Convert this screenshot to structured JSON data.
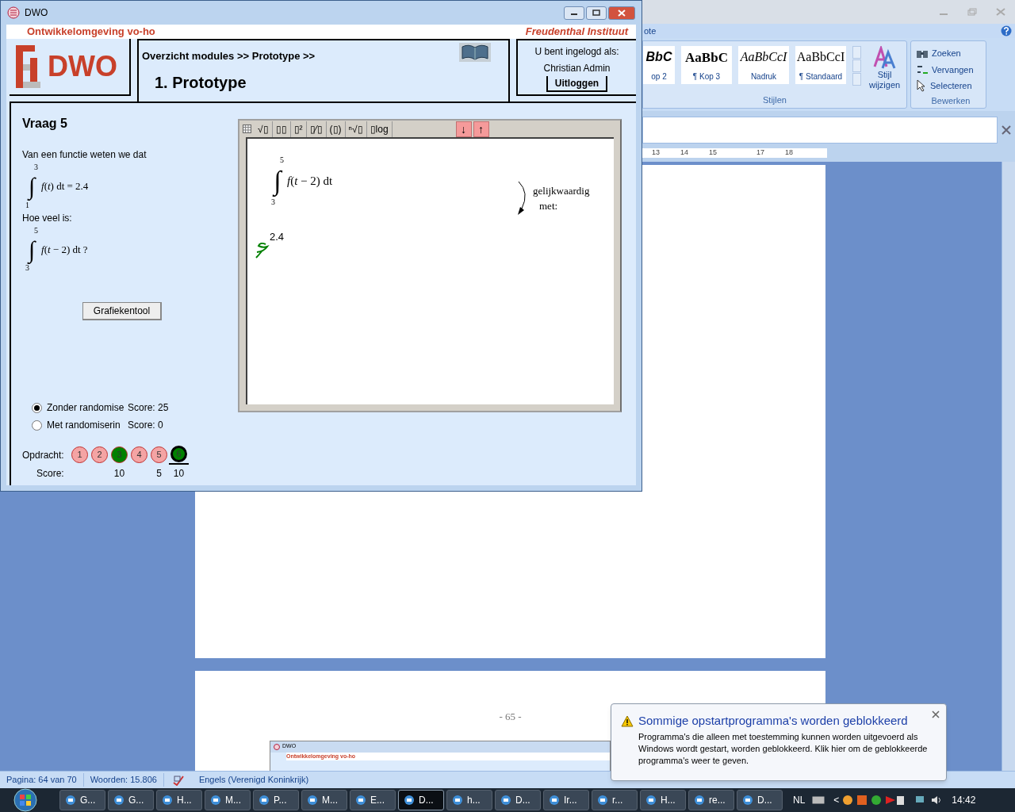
{
  "word": {
    "tab_fragment": "ote",
    "styles": [
      {
        "preview": "BbC",
        "name": "op 2",
        "kind": "bold"
      },
      {
        "preview": "AaBbC",
        "name": "¶ Kop 3",
        "kind": "serifbold"
      },
      {
        "preview": "AaBbCcI",
        "name": "Nadruk",
        "kind": "serifitalic"
      },
      {
        "preview": "AaBbCcI",
        "name": "¶ Standaard",
        "kind": "serif"
      }
    ],
    "change_style": [
      "Stijl",
      "wijzigen"
    ],
    "styles_group": "Stijlen",
    "edit_items": [
      {
        "label": "Zoeken",
        "kind": "find"
      },
      {
        "label": "Vervangen",
        "kind": "replace"
      },
      {
        "label": "Selecteren",
        "kind": "select"
      }
    ],
    "edit_group": "Bewerken",
    "ruler": [
      "13",
      "14",
      "15",
      "17",
      "18"
    ],
    "page_number": "- 65 -",
    "thumbnail": {
      "title": "DWO",
      "header": "Ontwikkelomgeving vo-ho"
    },
    "status_bar": [
      "Pagina: 64 van 70",
      "Woorden: 15.806",
      "Engels (Verenigd Koninkrijk)"
    ]
  },
  "dwo": {
    "title": "DWO",
    "header_left": "Ontwikkelomgeving vo-ho",
    "header_right": "Freudenthal Instituut",
    "logo_text": "DWO",
    "breadcrumb": "Overzicht modules >> Prototype >>",
    "page_title": "1.  Prototype",
    "login": {
      "label": "U bent ingelogd als:",
      "user": "Christian Admin",
      "logout": "Uitloggen"
    },
    "question": {
      "title": "Vraag 5",
      "intro": "Van een functie weten we dat",
      "given": {
        "upper": "3",
        "sign": "∫",
        "lower": "1",
        "expression": "*f*(*t*) dt = 2.4"
      },
      "prompt": "Hoe veel is:",
      "asked": {
        "upper": "5",
        "sign": "∫",
        "lower": "3",
        "expression": "*f*(*t* − 2) dt ?"
      }
    },
    "graph_button": "Grafiekentool",
    "editor": {
      "toolbar": [
        {
          "label": "√▯",
          "kind": "tool"
        },
        {
          "label": "▯▯",
          "kind": "tool"
        },
        {
          "label": "▯²",
          "kind": "tool"
        },
        {
          "label": "▯⁄▯",
          "kind": "tool"
        },
        {
          "label": "(▯)",
          "kind": "tool"
        },
        {
          "label": "ⁿ√▯",
          "kind": "tool"
        },
        {
          "label": "▯log",
          "kind": "tool"
        },
        {
          "label": "↓",
          "kind": "nav"
        },
        {
          "label": "↑",
          "kind": "nav"
        }
      ],
      "integral": {
        "upper": "5",
        "sign": "∫",
        "lower": "3",
        "expression": "*f*(*t* − 2) dt"
      },
      "equivalence": [
        "gelijkwaardig",
        "met:"
      ],
      "answer": "2.4"
    },
    "randomisation": [
      {
        "label": "Zonder randomise",
        "score": "Score: 25",
        "selected": true
      },
      {
        "label": "Met randomiserin",
        "score": "Score: 0",
        "selected": false
      }
    ],
    "tasks_label": "Opdracht:",
    "score_label": "Score:",
    "tasks": [
      {
        "number": "1",
        "color": "#f4a4a4",
        "selected": false
      },
      {
        "number": "2",
        "color": "#f4a4a4",
        "selected": false
      },
      {
        "number": "3",
        "color": "#008000",
        "selected": false,
        "score": "10"
      },
      {
        "number": "4",
        "color": "#f4a4a4",
        "selected": false
      },
      {
        "number": "5",
        "color": "#f4a4a4",
        "selected": false,
        "score": "5"
      },
      {
        "number": "6",
        "color": "#008000",
        "selected": true,
        "score": "10"
      }
    ]
  },
  "notification": {
    "title": "Sommige opstartprogramma's worden geblokkeerd",
    "body": "Programma's die alleen met toestemming kunnen worden uitgevoerd als Windows wordt gestart, worden geblokkeerd. Klik hier om de geblokkeerde programma's weer te geven."
  },
  "taskbar": {
    "items": [
      {
        "label": "G...",
        "selected": false
      },
      {
        "label": "G...",
        "selected": false
      },
      {
        "label": "H...",
        "selected": false
      },
      {
        "label": "M...",
        "selected": false
      },
      {
        "label": "P...",
        "selected": false
      },
      {
        "label": "M...",
        "selected": false
      },
      {
        "label": "E...",
        "selected": false
      },
      {
        "label": "D...",
        "selected": true
      },
      {
        "label": "h...",
        "selected": false
      },
      {
        "label": "D...",
        "selected": false
      },
      {
        "label": "Ir...",
        "selected": false
      },
      {
        "label": "r...",
        "selected": false
      },
      {
        "label": "H...",
        "selected": false
      },
      {
        "label": "re...",
        "selected": false
      },
      {
        "label": "D...",
        "selected": false
      }
    ],
    "language": "NL",
    "chevron": "<",
    "clock": "14:42"
  }
}
